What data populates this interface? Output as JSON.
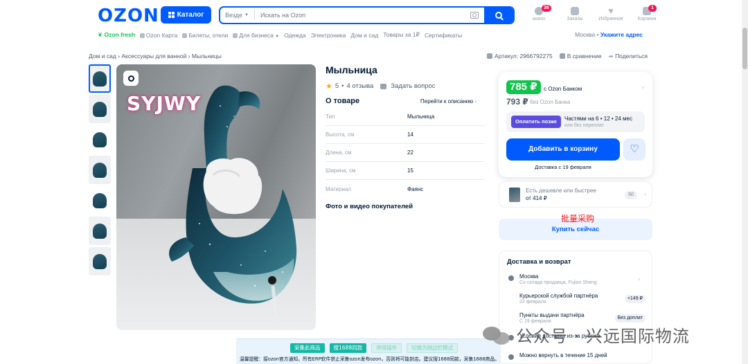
{
  "header": {
    "logo": "OZON",
    "catalog": "Каталог",
    "search": {
      "scope": "Везде",
      "placeholder": "Искать на Ozon"
    },
    "icons": [
      {
        "label": "ккаоо",
        "badge": "36",
        "icon": "profile-icon"
      },
      {
        "label": "Заказы",
        "badge": "",
        "icon": "box-icon"
      },
      {
        "label": "Избранное",
        "badge": "",
        "icon": "heart-icon"
      },
      {
        "label": "Корзина",
        "badge": "1",
        "icon": "cart-icon"
      }
    ]
  },
  "subnav": {
    "items": [
      "Ozon fresh",
      "Ozon Карта",
      "Билеты, отели",
      "Для бизнеса",
      "Одежда",
      "Электроника",
      "Дом и сад",
      "Товары за 1₽",
      "Сертификаты"
    ],
    "location_city": "Москва",
    "location_link": "Укажите адрес"
  },
  "breadcrumbs": "Дом и сад › Аксессуары для ванной › Мыльницы",
  "meta": {
    "article": "Артикул: 2966792275",
    "compare": "В сравнение",
    "share": "Поделиться"
  },
  "product": {
    "title": "Мыльница",
    "rating": "5",
    "reviews": "4 отзыва",
    "ask": "Задать вопрос",
    "photo_brand": "SYJWY",
    "about_title": "О товаре",
    "to_description": "Перейти к описанию",
    "specs": [
      {
        "k": "Тип",
        "v": "Мыльница"
      },
      {
        "k": "Высота, см",
        "v": "14"
      },
      {
        "k": "Длина, см",
        "v": "22"
      },
      {
        "k": "Ширина, см",
        "v": "15"
      },
      {
        "k": "Материал",
        "v": "Фаянс"
      }
    ],
    "ugc_title": "Фото и видео покупателей"
  },
  "price": {
    "main": "785 ₽",
    "main_label": "с Ozon Банком",
    "old": "793 ₽",
    "old_label": "без Ozon Банка",
    "installment_btn": "Оплатить позже",
    "installment_text": "Частями на 6 • 12 • 24 мес",
    "installment_sub": "или без переплат",
    "cart_btn": "Добавить в корзину",
    "delivery_note": "Доставка с 19 февраля"
  },
  "cheaper": {
    "line1": "Есть дешевле или быстрее",
    "line2": "от 414 ₽",
    "count": "50"
  },
  "bulk_label": "批量采购",
  "buy_now": "Купить сейчас",
  "delivery": {
    "title": "Доставка и возврат",
    "rows": [
      {
        "r1": "Москва",
        "r2": "Со склада продавца, Fujian Sheng",
        "tag": ""
      },
      {
        "r1": "Курьерской службой партнёра",
        "r2": "22 февраля",
        "tag": "+149 ₽"
      },
      {
        "r1": "Пункты выдачи партнёра",
        "r2": "С 19 февраля",
        "tag": "Без доплат"
      },
      {
        "r1": "Условия доставки из-за рубежа",
        "r2": "",
        "tag": ""
      },
      {
        "r1": "Можно вернуть в течение 15 дней",
        "r2": "",
        "tag": ""
      }
    ]
  },
  "plugin": {
    "buttons": [
      "采集此商品",
      "搜1688同款",
      "停用插件",
      "切换为侧边栏模式"
    ],
    "note": "温馨提醒：接ozon官方通知，所有ERP软件禁止采集ozon发布ozon，否则将可能封店。建议搜1688同款，采集1688商品。"
  },
  "watermark": "公众号 · 兴远国际物流"
}
